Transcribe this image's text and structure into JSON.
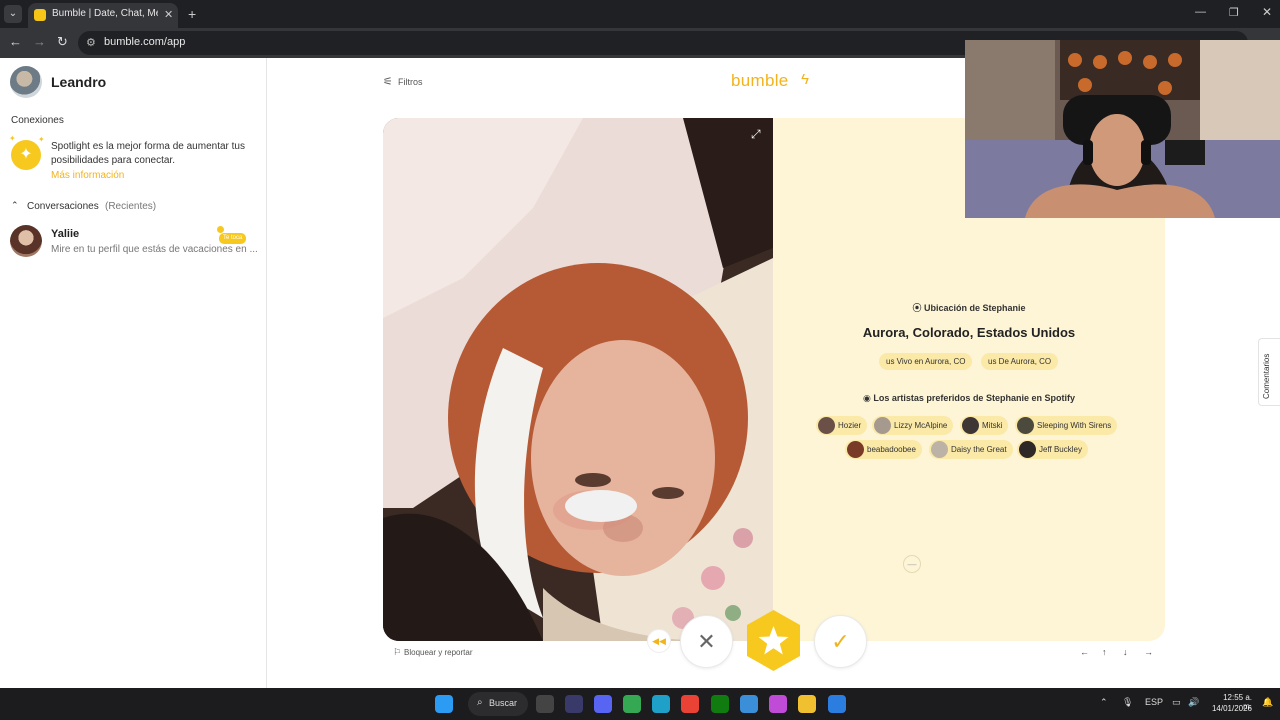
{
  "browser": {
    "tab_title": "Bumble | Date, Chat, Meet New",
    "tab_close": "✕",
    "new_tab": "+",
    "url": "bumble.com/app",
    "nav_back": "←",
    "nav_forward": "→",
    "nav_reload": "↻",
    "win_min": "—",
    "win_max": "❐",
    "win_close": "✕"
  },
  "sidebar": {
    "username": "Leandro",
    "conexiones_title": "Conexiones",
    "spotlight_text": "Spotlight es la mejor forma de aumentar tus posibilidades para conectar.",
    "spotlight_link": "Más información",
    "conversations_title": "Conversaciones",
    "conversations_subtitle": "(Recientes)",
    "conversations": [
      {
        "name": "Yaliie",
        "badge": "Te toca",
        "preview": "Mire en tu perfil que estás de vacaciones en ..."
      }
    ]
  },
  "header": {
    "filter_label": "Filtros",
    "logo": "bumble"
  },
  "profile": {
    "location_header": "Ubicación de Stephanie",
    "location_city": "Aurora, Colorado, Estados Unidos",
    "location_chips": [
      "us Vivo en Aurora, CO",
      "us De Aurora, CO"
    ],
    "spotify_header": "Los artistas preferidos de Stephanie en Spotify",
    "artists_row1": [
      "Hozier",
      "Lizzy McAlpine",
      "Mitski",
      "Sleeping With Sirens"
    ],
    "artists_row2": [
      "beabadoobee",
      "Daisy the Great",
      "Jeff Buckley"
    ]
  },
  "footer": {
    "report_label": "Bloquear y reportar",
    "shortcuts": [
      "←",
      "↑",
      "↓",
      "→"
    ]
  },
  "feedback_label": "Comentarios",
  "taskbar": {
    "search_label": "Buscar",
    "lang": "ESP",
    "time": "12:55 a. m.",
    "date": "14/01/2026"
  },
  "colors": {
    "brand_yellow": "#f7c81e",
    "card_info_bg": "#fdf5d6",
    "chip_bg": "#fbe9a8"
  }
}
